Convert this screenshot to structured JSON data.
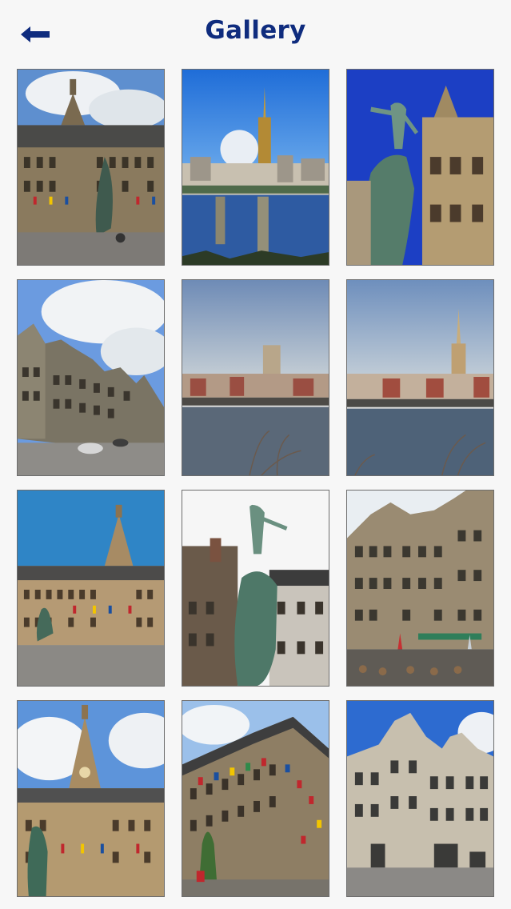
{
  "header": {
    "title": "Gallery",
    "back_icon": "arrow-left-icon",
    "accent_color": "#0f2c7e"
  },
  "gallery": {
    "items": [
      {
        "subject": "town-hall-with-statue"
      },
      {
        "subject": "cathedral-skyline-river"
      },
      {
        "subject": "brabo-fountain-closeup"
      },
      {
        "subject": "guild-houses-street"
      },
      {
        "subject": "river-tower-view"
      },
      {
        "subject": "river-spire-view"
      },
      {
        "subject": "town-hall-square"
      },
      {
        "subject": "brabo-statue-rooftops"
      },
      {
        "subject": "guild-houses-cafe"
      },
      {
        "subject": "town-hall-facade-statue"
      },
      {
        "subject": "building-with-flags"
      },
      {
        "subject": "gabled-houses"
      }
    ]
  }
}
